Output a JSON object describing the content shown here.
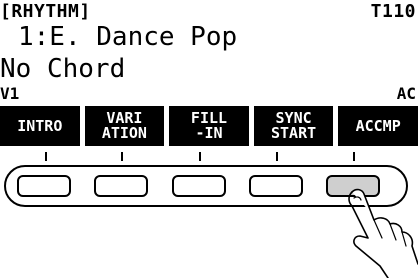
{
  "display": {
    "mode": "[RHYTHM]",
    "tempo": "T110",
    "rhythm": "1:E. Dance Pop",
    "chord": "No Chord",
    "variation": "V1",
    "accomp": "AC"
  },
  "softkeys": [
    {
      "line1": "INTRO",
      "line2": ""
    },
    {
      "line1": "VARI",
      "line2": "ATION"
    },
    {
      "line1": "FILL",
      "line2": "-IN"
    },
    {
      "line1": "SYNC",
      "line2": "START"
    },
    {
      "line1": "ACCMP",
      "line2": ""
    }
  ],
  "buttons": [
    {
      "pressed": false
    },
    {
      "pressed": false
    },
    {
      "pressed": false
    },
    {
      "pressed": false
    },
    {
      "pressed": true
    }
  ],
  "colors": {
    "lcd_bg": "#ffffff",
    "ink": "#000000",
    "pressed_button": "#cfcfcf"
  },
  "icons": {
    "finger": "pointing-finger-icon"
  }
}
